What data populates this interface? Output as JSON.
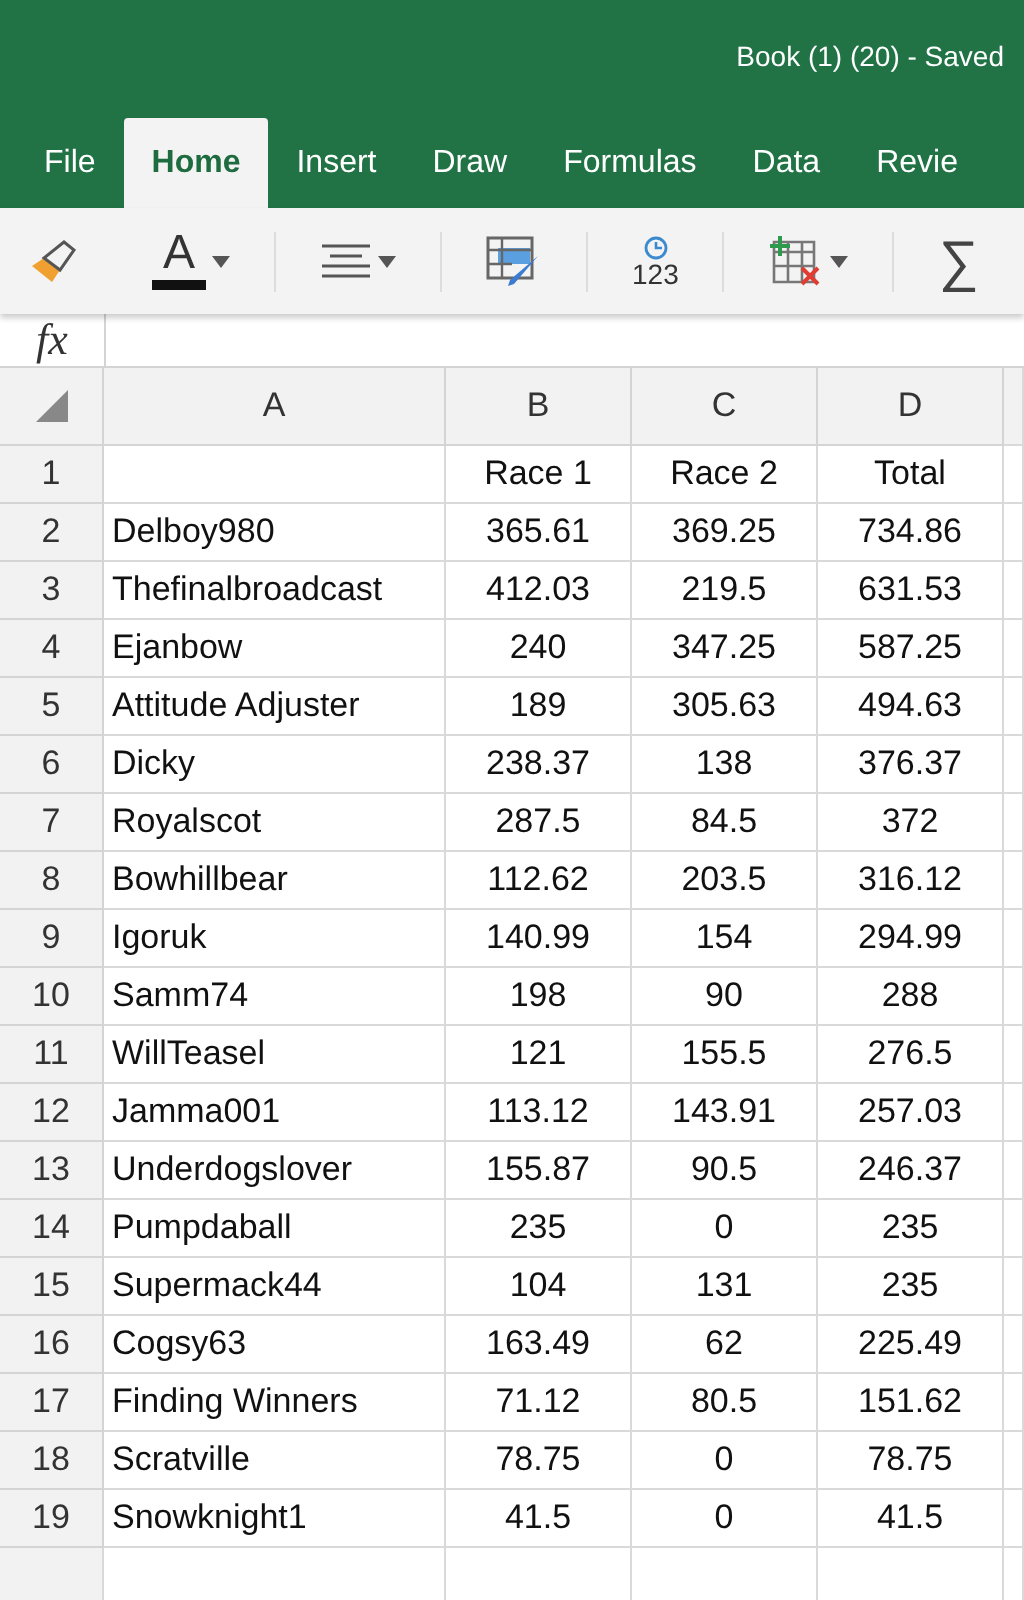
{
  "window": {
    "title": "Book (1) (20) - Saved"
  },
  "tabs": [
    {
      "label": "File",
      "selected": false
    },
    {
      "label": "Home",
      "selected": true
    },
    {
      "label": "Insert",
      "selected": false
    },
    {
      "label": "Draw",
      "selected": false
    },
    {
      "label": "Formulas",
      "selected": false
    },
    {
      "label": "Data",
      "selected": false
    },
    {
      "label": "Revie",
      "selected": false
    }
  ],
  "toolbar": [
    {
      "kind": "brush",
      "caret": false
    },
    {
      "kind": "font-color",
      "glyph": "A",
      "caret": true
    },
    {
      "kind": "align",
      "caret": true
    },
    {
      "kind": "format",
      "caret": false
    },
    {
      "kind": "number",
      "glyph": "123",
      "caret": false
    },
    {
      "kind": "cells",
      "caret": true
    },
    {
      "kind": "sum",
      "glyph": "∑",
      "caret": false
    }
  ],
  "formula_bar": {
    "label": "fx"
  },
  "table": {
    "columns": [
      "A",
      "B",
      "C",
      "D"
    ],
    "rows": [
      {
        "number": "1",
        "cells": [
          "",
          "Race 1",
          "Race 2",
          "Total"
        ]
      },
      {
        "number": "2",
        "cells": [
          "Delboy980",
          "365.61",
          "369.25",
          "734.86"
        ]
      },
      {
        "number": "3",
        "cells": [
          "Thefinalbroadcast",
          "412.03",
          "219.5",
          "631.53"
        ]
      },
      {
        "number": "4",
        "cells": [
          "Ejanbow",
          "240",
          "347.25",
          "587.25"
        ]
      },
      {
        "number": "5",
        "cells": [
          "Attitude Adjuster",
          "189",
          "305.63",
          "494.63"
        ]
      },
      {
        "number": "6",
        "cells": [
          "Dicky",
          "238.37",
          "138",
          "376.37"
        ]
      },
      {
        "number": "7",
        "cells": [
          "Royalscot",
          "287.5",
          "84.5",
          "372"
        ]
      },
      {
        "number": "8",
        "cells": [
          "Bowhillbear",
          "112.62",
          "203.5",
          "316.12"
        ]
      },
      {
        "number": "9",
        "cells": [
          "Igoruk",
          "140.99",
          "154",
          "294.99"
        ]
      },
      {
        "number": "10",
        "cells": [
          "Samm74",
          "198",
          "90",
          "288"
        ]
      },
      {
        "number": "11",
        "cells": [
          "WillTeasel",
          "121",
          "155.5",
          "276.5"
        ]
      },
      {
        "number": "12",
        "cells": [
          "Jamma001",
          "113.12",
          "143.91",
          "257.03"
        ]
      },
      {
        "number": "13",
        "cells": [
          "Underdogslover",
          "155.87",
          "90.5",
          "246.37"
        ]
      },
      {
        "number": "14",
        "cells": [
          "Pumpdaball",
          "235",
          "0",
          "235"
        ]
      },
      {
        "number": "15",
        "cells": [
          "Supermack44",
          "104",
          "131",
          "235"
        ]
      },
      {
        "number": "16",
        "cells": [
          "Cogsy63",
          "163.49",
          "62",
          "225.49"
        ]
      },
      {
        "number": "17",
        "cells": [
          "Finding Winners",
          "71.12",
          "80.5",
          "151.62"
        ]
      },
      {
        "number": "18",
        "cells": [
          "Scratville",
          "78.75",
          "0",
          "78.75"
        ]
      },
      {
        "number": "19",
        "cells": [
          "Snowknight1",
          "41.5",
          "0",
          "41.5"
        ]
      }
    ]
  }
}
